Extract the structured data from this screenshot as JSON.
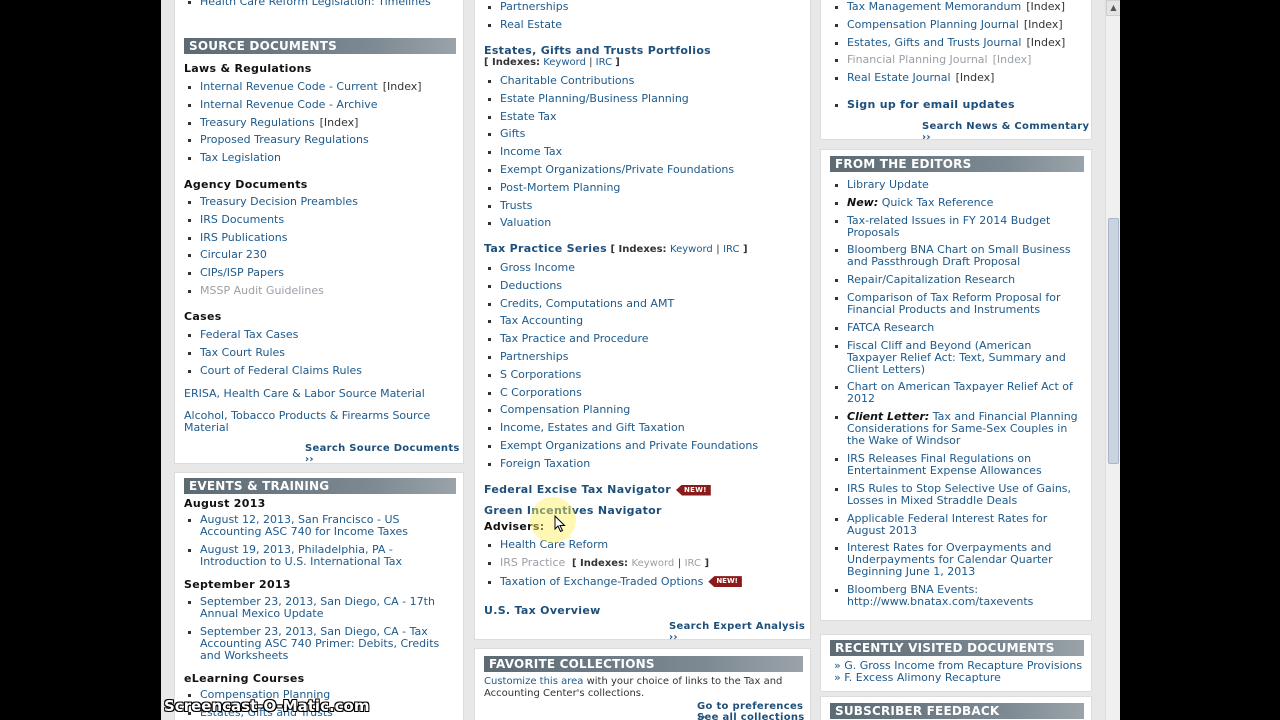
{
  "col1": {
    "top_item": "Health Care Reform Legislation: Timelines",
    "source": {
      "heading": "SOURCE DOCUMENTS",
      "laws_title": "Laws & Regulations",
      "laws": [
        {
          "label": "Internal Revenue Code - Current",
          "index": "[Index]"
        },
        {
          "label": "Internal Revenue Code - Archive",
          "index": ""
        },
        {
          "label": "Treasury Regulations",
          "index": "[Index]"
        },
        {
          "label": "Proposed Treasury Regulations",
          "index": ""
        },
        {
          "label": "Tax Legislation",
          "index": ""
        }
      ],
      "agency_title": "Agency Documents",
      "agency": [
        "Treasury Decision Preambles",
        "IRS Documents",
        "IRS Publications",
        "Circular 230",
        "CIPs/ISP Papers",
        "MSSP Audit Guidelines"
      ],
      "cases_title": "Cases",
      "cases": [
        "Federal Tax Cases",
        "Tax Court Rules",
        "Court of Federal Claims Rules"
      ],
      "erisa": "ERISA, Health Care & Labor Source Material",
      "alcohol": "Alcohol, Tobacco Products & Firearms Source Material",
      "search": "Search Source Documents ››"
    },
    "events": {
      "heading": "EVENTS & TRAINING",
      "aug_title": "August 2013",
      "aug": [
        "August 12, 2013, San Francisco - US Accounting ASC 740 for Income Taxes",
        "August 19, 2013, Philadelphia, PA - Introduction to U.S. International Tax"
      ],
      "sep_title": "September 2013",
      "sep": [
        "September 23, 2013, San Diego, CA - 17th Annual Mexico Update",
        "September 23, 2013, San Diego, CA - Tax Accounting ASC 740 Primer: Debits, Credits and Worksheets"
      ],
      "elearn_title": "eLearning Courses",
      "elearn": [
        "Compensation Planning",
        "Estates, Gifts and Trusts"
      ]
    }
  },
  "col2": {
    "top_items": [
      "Partnerships",
      "Real Estate"
    ],
    "egt_title": "Estates, Gifts and Trusts Portfolios",
    "egt_indexes": {
      "open": "[ Indexes:",
      "keyword": "Keyword",
      "sep": "|",
      "irc": "IRC",
      "close": "]"
    },
    "egt": [
      "Charitable Contributions",
      "Estate Planning/Business Planning",
      "Estate Tax",
      "Gifts",
      "Income Tax",
      "Exempt Organizations/Private Foundations",
      "Post-Mortem Planning",
      "Trusts",
      "Valuation"
    ],
    "tps_title": "Tax Practice Series",
    "tps_indexes": {
      "open": "[ Indexes:",
      "keyword": "Keyword",
      "sep": "|",
      "irc": "IRC",
      "close": "]"
    },
    "tps": [
      "Gross Income",
      "Deductions",
      "Credits, Computations and AMT",
      "Tax Accounting",
      "Tax Practice and Procedure",
      "Partnerships",
      "S Corporations",
      "C Corporations",
      "Compensation Planning",
      "Income, Estates and Gift Taxation",
      "Exempt Organizations and Private Foundations",
      "Foreign Taxation"
    ],
    "excise": "Federal Excise Tax Navigator",
    "new_badge": "NEW!",
    "green": "Green Incentives Navigator",
    "advisers_title": "Advisers:",
    "advisers": {
      "health": "Health Care Reform",
      "irs_practice": "IRS Practice",
      "irs_indexes": {
        "open": "[ Indexes:",
        "keyword": "Keyword",
        "sep": "|",
        "irc": "IRC",
        "close": "]"
      },
      "etf": "Taxation of Exchange-Traded Options"
    },
    "us_overview": "U.S. Tax Overview",
    "search": "Search Expert Analysis ››",
    "fav": {
      "heading": "FAVORITE COLLECTIONS",
      "customize": "Customize this area",
      "intro_rest": " with your choice of links to the Tax and Accounting Center's collections.",
      "prefs": "Go to preferences ››",
      "all": "See all collections ››"
    }
  },
  "col3": {
    "journals": [
      {
        "label": "Tax Management Memorandum",
        "index": "[Index]",
        "gray": false
      },
      {
        "label": "Compensation Planning Journal",
        "index": "[Index]",
        "gray": false
      },
      {
        "label": "Estates, Gifts and Trusts Journal",
        "index": "[Index]",
        "gray": false
      },
      {
        "label": "Financial Planning Journal",
        "index": "[Index]",
        "gray": true
      },
      {
        "label": "Real Estate Journal",
        "index": "[Index]",
        "gray": false
      }
    ],
    "signup": "Sign up for email updates",
    "search_news": "Search News & Commentary ››",
    "editors": {
      "heading": "FROM THE EDITORS",
      "items": [
        {
          "prefix": "",
          "text": "Library Update"
        },
        {
          "prefix": "New:",
          "text": " Quick Tax Reference"
        },
        {
          "prefix": "",
          "text": "Tax-related Issues in FY 2014 Budget Proposals"
        },
        {
          "prefix": "",
          "text": "Bloomberg BNA Chart on Small Business and Passthrough Draft Proposal"
        },
        {
          "prefix": "",
          "text": "Repair/Capitalization Research"
        },
        {
          "prefix": "",
          "text": "Comparison of Tax Reform Proposal for Financial Products and Instruments"
        },
        {
          "prefix": "",
          "text": "FATCA Research"
        },
        {
          "prefix": "",
          "text": "Fiscal Cliff and Beyond (American Taxpayer Relief Act: Text, Summary and Client Letters)"
        },
        {
          "prefix": "",
          "text": "Chart on American Taxpayer Relief Act of 2012"
        },
        {
          "prefix": "Client Letter:",
          "text": " Tax and Financial Planning Considerations for Same-Sex Couples in the Wake of Windsor"
        },
        {
          "prefix": "",
          "text": "IRS Releases Final Regulations on Entertainment Expense Allowances"
        },
        {
          "prefix": "",
          "text": "IRS Rules to Stop Selective Use of Gains, Losses in Mixed Straddle Deals"
        },
        {
          "prefix": "",
          "text": "Applicable Federal Interest Rates for August 2013"
        },
        {
          "prefix": "",
          "text": "Interest Rates for Overpayments and Underpayments for Calendar Quarter Beginning June 1, 2013"
        },
        {
          "prefix": "",
          "text": "Bloomberg BNA Events: http://www.bnatax.com/taxevents"
        }
      ]
    },
    "recent": {
      "heading": "RECENTLY VISITED DOCUMENTS",
      "items": [
        "» G. Gross Income from Recapture Provisions",
        "» F. Excess Alimony Recapture"
      ]
    },
    "feedback": {
      "heading": "SUBSCRIBER FEEDBACK"
    }
  },
  "scroll": {
    "up_arrow": "▲"
  },
  "watermark": "Screencast-O-Matic.com"
}
